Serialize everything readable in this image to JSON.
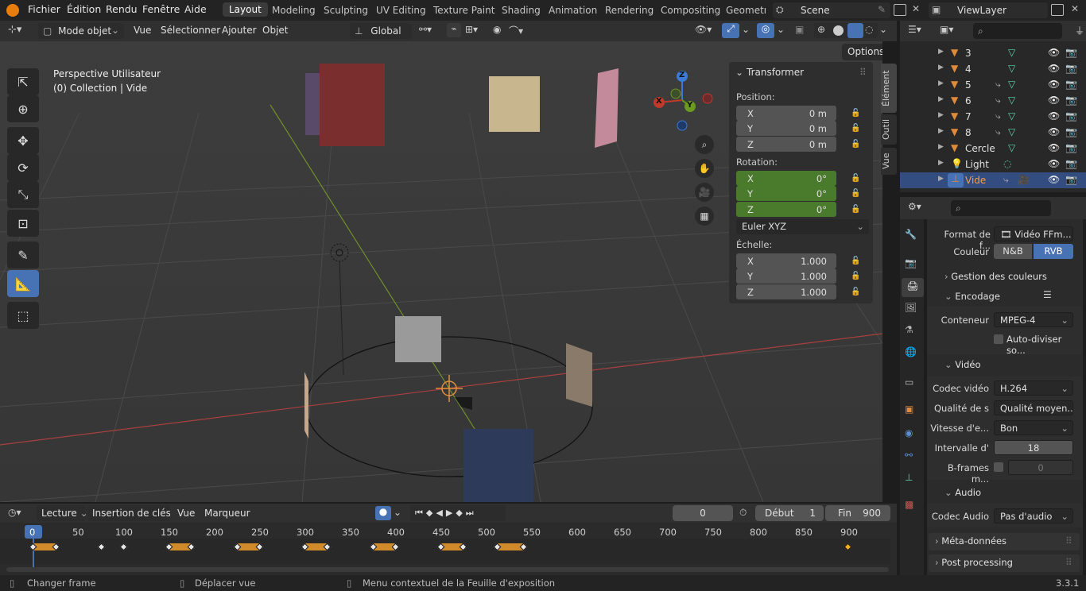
{
  "menu": {
    "items": [
      "Fichier",
      "Édition",
      "Rendu",
      "Fenêtre",
      "Aide"
    ]
  },
  "workspaces": [
    "Layout",
    "Modeling",
    "Sculpting",
    "UV Editing",
    "Texture Paint",
    "Shading",
    "Animation",
    "Rendering",
    "Compositing",
    "Geometry"
  ],
  "scene": {
    "name": "Scene",
    "view_layer": "ViewLayer"
  },
  "viewport_header": {
    "mode": "Mode objet",
    "items": [
      "Vue",
      "Sélectionner",
      "Ajouter",
      "Objet"
    ],
    "orientation": "Global",
    "options": "Options"
  },
  "viewport": {
    "title": "Perspective Utilisateur",
    "subtitle": "(0) Collection | Vide",
    "gizmo": {
      "z": "Z",
      "y": "Y",
      "x": "X"
    }
  },
  "npanel": {
    "title": "Transformer",
    "position_label": "Position:",
    "position": [
      {
        "axis": "X",
        "value": "0 m"
      },
      {
        "axis": "Y",
        "value": "0 m"
      },
      {
        "axis": "Z",
        "value": "0 m"
      }
    ],
    "rotation_label": "Rotation:",
    "rotation": [
      {
        "axis": "X",
        "value": "0°"
      },
      {
        "axis": "Y",
        "value": "0°"
      },
      {
        "axis": "Z",
        "value": "0°"
      }
    ],
    "rotation_mode": "Euler XYZ",
    "scale_label": "Échelle:",
    "scale": [
      {
        "axis": "X",
        "value": "1.000"
      },
      {
        "axis": "Y",
        "value": "1.000"
      },
      {
        "axis": "Z",
        "value": "1.000"
      }
    ],
    "tabs": [
      "Élément",
      "Outil",
      "Vue"
    ]
  },
  "outliner": {
    "rows": [
      {
        "name": "3",
        "type": "mesh"
      },
      {
        "name": "4",
        "type": "mesh"
      },
      {
        "name": "5",
        "type": "mesh"
      },
      {
        "name": "6",
        "type": "mesh"
      },
      {
        "name": "7",
        "type": "mesh"
      },
      {
        "name": "8",
        "type": "mesh"
      },
      {
        "name": "Cercle",
        "type": "curve"
      },
      {
        "name": "Light",
        "type": "light"
      },
      {
        "name": "Vide",
        "type": "empty",
        "selected": true
      }
    ]
  },
  "properties": {
    "format_label": "Format de f...",
    "format_value": "Vidéo FFm...",
    "color_label": "Couleur",
    "color_options": [
      "N&B",
      "RVB"
    ],
    "color_mgmt": "Gestion des couleurs",
    "encoding": "Encodage",
    "container_label": "Conteneur",
    "container_value": "MPEG-4",
    "autosplit": "Auto-diviser so...",
    "video": "Vidéo",
    "codec_label": "Codec vidéo",
    "codec_value": "H.264",
    "quality_label": "Qualité de s",
    "quality_value": "Qualité moyen...",
    "speed_label": "Vitesse d'e...",
    "speed_value": "Bon",
    "interval_label": "Intervalle d'",
    "interval_value": "18",
    "bframes_label": "B-frames m...",
    "bframes_value": "0",
    "audio": "Audio",
    "audio_codec_label": "Codec Audio",
    "audio_codec_value": "Pas d'audio",
    "metadata": "Méta-données",
    "postprocessing": "Post processing"
  },
  "timeline": {
    "menus": [
      "Lecture",
      "Insertion de clés",
      "Vue",
      "Marqueur"
    ],
    "current_frame": "0",
    "start_label": "Début",
    "start": "1",
    "end_label": "Fin",
    "end": "900",
    "ticks": [
      "0",
      "50",
      "100",
      "150",
      "200",
      "250",
      "300",
      "350",
      "400",
      "450",
      "500",
      "550",
      "600",
      "650",
      "700",
      "750",
      "800",
      "850",
      "900"
    ]
  },
  "status": {
    "left": "Changer frame",
    "middle": "Déplacer vue",
    "right": "Menu contextuel de la Feuille d'exposition",
    "version": "3.3.1"
  },
  "colors": {
    "accent": "#4772b3",
    "green": "#4a7a2c",
    "orange": "#d08a2a",
    "x_axis": "#c0392b",
    "y_axis": "#6a9a1f"
  }
}
